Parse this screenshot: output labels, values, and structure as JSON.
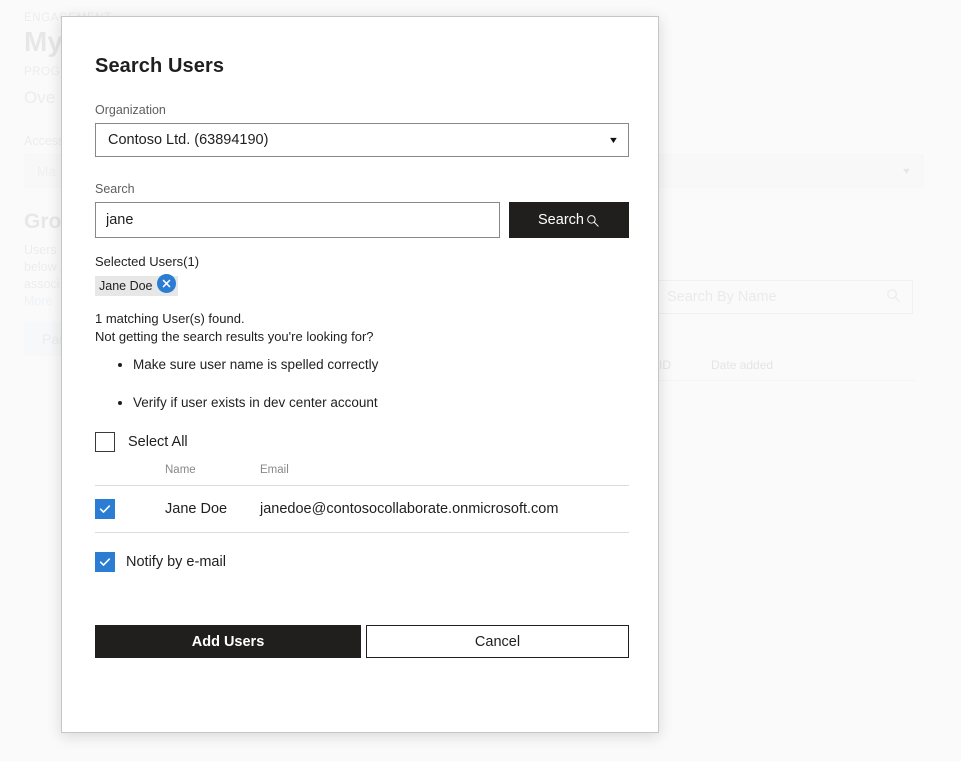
{
  "background": {
    "eyebrow": "ENGAGEMENT",
    "page_title": "My",
    "program_label": "PROGRAM",
    "tab_label": "Ove",
    "access_label": "Access",
    "dropdown_value": "Ma",
    "group_heading": "Gro",
    "description_line1": "Users",
    "description_line2": "below",
    "description_line3": "associ",
    "more_link": "More",
    "pill_label": "Par",
    "search_placeholder": "Search By Name",
    "search_icon": "search-icon",
    "table_headers": [
      "Seller ID",
      "Date added"
    ]
  },
  "dialog": {
    "title": "Search Users",
    "organization": {
      "label": "Organization",
      "value": "Contoso Ltd. (63894190)",
      "caret_icon": "chevron-down-icon"
    },
    "search": {
      "label": "Search",
      "value": "jane",
      "placeholder": "",
      "button_label": "Search",
      "button_icon": "search-icon"
    },
    "selected_users": {
      "label": "Selected Users(1)",
      "chips": [
        {
          "name": "Jane Doe",
          "remove_icon": "close-circle-icon"
        }
      ]
    },
    "results": {
      "count_text": "1 matching User(s) found.",
      "prompt_text": "Not getting the search results you're looking for?",
      "hints": [
        "Make sure user name is spelled correctly",
        "Verify if user exists in dev center account"
      ]
    },
    "select_all": {
      "label": "Select All",
      "checked": false
    },
    "table": {
      "headers": {
        "name": "Name",
        "email": "Email"
      },
      "rows": [
        {
          "checked": true,
          "name": "Jane Doe",
          "email": "janedoe@contosocollaborate.onmicrosoft.com"
        }
      ]
    },
    "notify": {
      "label": "Notify by e-mail",
      "checked": true
    },
    "footer": {
      "primary_label": "Add Users",
      "secondary_label": "Cancel"
    }
  },
  "colors": {
    "accent_blue": "#2b7cd3",
    "dark_button": "#201f1e",
    "chip_background": "#e7e7e7",
    "border": "#8a8886"
  }
}
